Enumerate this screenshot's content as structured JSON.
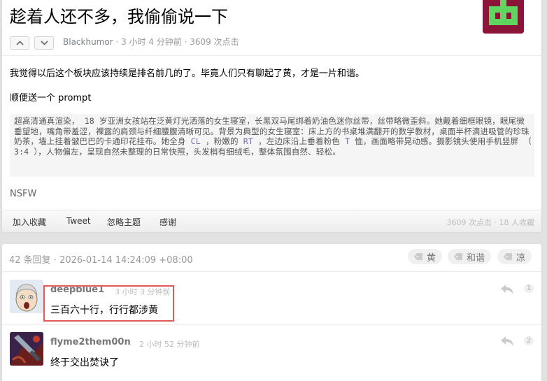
{
  "topic": {
    "title": "趁着人还不多，我偷偷说一下",
    "author": "Blackhumor",
    "meta_rest": " · 3 小时 4 分钟前 · 3609 次点击",
    "paragraph1": "我觉得以后这个板块应该持续是排名前几的了。毕竟人们只有聊起了黄，才是一片和谐。",
    "paragraph2": "顺便送一个 prompt",
    "prompt": {
      "p1": "超高清通真渲染， 18 岁亚洲女孩站在泛黄灯光洒落的女生寝室，长黑双马尾绑着奶油色迷你丝带，丝带略微歪斜。她戴着细框眼镜，眼尾微垂望地，嘴角带羞涩，裸露的肩颈与纤细腰腹清晰可见。背景为典型的女生寝室：床上方的书桌堆满翻开的数学教材，桌面半杯滴进吸管的珍珠奶茶，墙上挂着皱巴巴的卡通印花挂布。她全身 ",
      "code1": "CL",
      "p2": " ，粉嫩的 ",
      "code2": "RT",
      "p3": " ，左边床沿上垂着粉色 ",
      "code3": "T",
      "p4": " 恤，画面略带晃动感。摄影镜头使用手机竖屏 （ 3:4 ），人物偏左，呈现自然未整理的日常快照，头发梢有细绒毛，整体氛围自然、轻松。"
    },
    "tag_line": "NSFW"
  },
  "toolbar": {
    "favorite": "加入收藏",
    "tweet": "Tweet",
    "ignore": "忽略主题",
    "thanks": "感谢",
    "stats": "3609 次点击 · 18 人收藏"
  },
  "replies": {
    "header": "42 条回复 · 2026-01-14 14:24:09 +08:00",
    "tags": [
      "黄",
      "和谐",
      "凉"
    ],
    "items": [
      {
        "name": "deepblue1",
        "time": "3 小时 3 分钟前",
        "content": "三百六十行，行行都涉黄",
        "floor": "1"
      },
      {
        "name": "flyme2them00n",
        "time": "2 小时 52 分钟前",
        "content": "终于交出焚诀了",
        "floor": "2"
      }
    ]
  },
  "colors": {
    "avatar_bg": "#8b1538",
    "avatar_fg": "#5fd65f",
    "highlight": "#e05a5a"
  }
}
